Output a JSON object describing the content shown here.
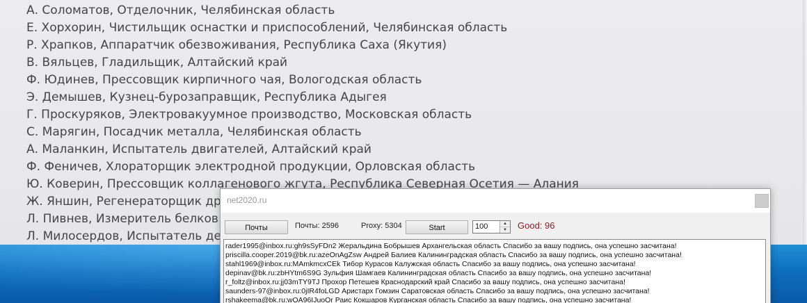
{
  "background_page": {
    "names": [
      "А. Соломатов, Отделочник, Челябинская область",
      "Е. Хорхорин, Чистильщик оснастки и приспособлений, Челябинская область",
      "Р. Храпков, Аппаратчик обезвоживания, Республика Саха (Якутия)",
      "В. Вяльцев, Гладильщик, Алтайский край",
      "Ф. Юдинев, Прессовщик кирпичного чая, Вологодская область",
      "Э. Демышев, Кузнец-бурозаправщик, Республика Адыгея",
      "Г. Проскуряков, Электровакуумное производство, Московская область",
      "С. Марягин, Посадчик металла, Челябинская область",
      "А. Маланкин, Испытатель двигателей, Алтайский край",
      "Ф. Феничев, Хлораторщик электродной продукции, Орловская область",
      "Ю. Коверин, Прессовщик коллагенового жгута, Республика Северная Осетия — Алания",
      "Ж. Яншин, Регенераторщик др",
      "Л. Пивнев, Измеритель белков",
      "Л. Милосердов, Испытатель де"
    ]
  },
  "app": {
    "title": "net2020.ru",
    "toolbar": {
      "mails_button": "Почты",
      "mails_count": "Почты: 2596",
      "proxy_count": "Proxy: 5304",
      "start_button": "Start",
      "threads_value": "100",
      "good_label": "Good: 96"
    },
    "log": [
      "rader1995@inbox.ru:gh9sSyFDn2 Жеральдина Бобрышев Архангельская область Спасибо за вашу подпись, она успешно засчитана!",
      "priscilla.cooper.2019@bk.ru:azeOnAgZsw Андрей Балиев Калининградская область Спасибо за вашу подпись, она успешно засчитана!",
      "stahl1969@inbox.ru:MAmkmcxCEk Тибор Курасов Калужская область Спасибо за вашу подпись, она успешно засчитана!",
      "depinav@bk.ru:zbHYtm6S9G Зульфия Шамгаев Калининградская область Спасибо за вашу подпись, она успешно засчитана!",
      "r_foltz@inbox.ru:jj03mTY9TJ Прохор Петешев Краснодарский край Спасибо за вашу подпись, она успешно засчитана!",
      "saunders-97@inbox.ru:0jIR4foLGD Аристарх Гомзин Саратовская область Спасибо за вашу подпись, она успешно засчитана!",
      "rshakeema@bk.ru:wOA96IJuoOr Раис Кокшаров Курганская область Спасибо за вашу подпись, она успешно засчитана!"
    ]
  },
  "colors": {
    "good_text": "#8c1f24",
    "desktop_blue": "#0e6fbe"
  }
}
